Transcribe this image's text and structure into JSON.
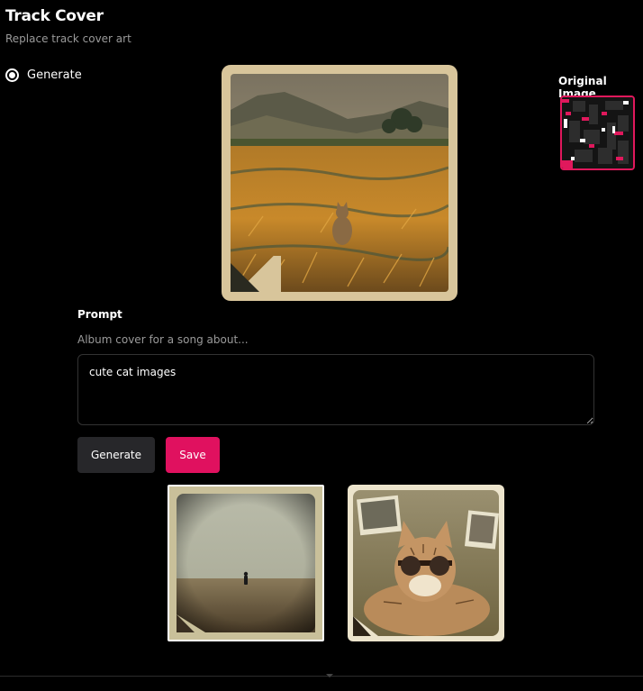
{
  "header": {
    "title": "Track Cover",
    "subtitle": "Replace track cover art"
  },
  "mode": {
    "option_label": "Generate",
    "selected": true
  },
  "original": {
    "label": "Original Image",
    "border_color": "#e0185c"
  },
  "prompt": {
    "label": "Prompt",
    "hint": "Album cover for a song about...",
    "value": "cute cat images"
  },
  "actions": {
    "generate_label": "Generate",
    "save_label": "Save",
    "save_color": "#e0115f"
  },
  "thumbnails": [
    {
      "subject": "lone figure in field",
      "selected": true
    },
    {
      "subject": "cat with sunglasses",
      "selected": false
    }
  ],
  "icons": {
    "radio": "radio-selected-icon",
    "fold": "page-corner-fold-icon"
  }
}
